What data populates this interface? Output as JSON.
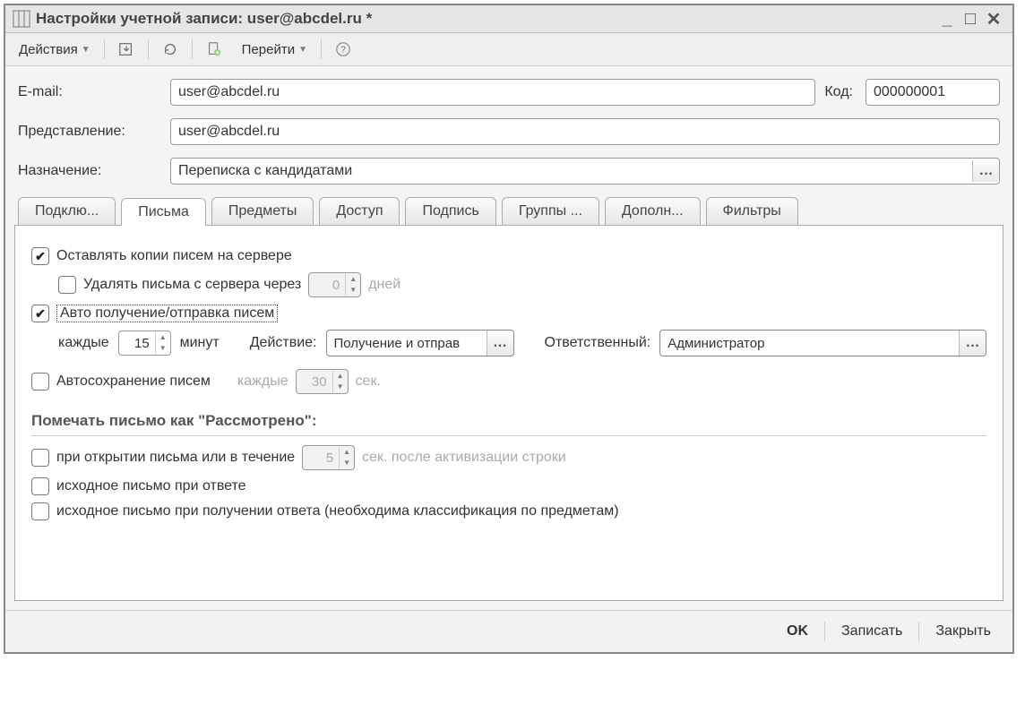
{
  "window": {
    "title": "Настройки учетной записи: user@abcdel.ru *"
  },
  "toolbar": {
    "actions_label": "Действия",
    "goto_label": "Перейти"
  },
  "form": {
    "email_label": "E-mail:",
    "email_value": "user@abcdel.ru",
    "code_label": "Код:",
    "code_value": "000000001",
    "repr_label": "Представление:",
    "repr_value": "user@abcdel.ru",
    "purpose_label": "Назначение:",
    "purpose_value": "Переписка с кандидатами"
  },
  "tabs": [
    "Подклю...",
    "Письма",
    "Предметы",
    "Доступ",
    "Подпись",
    "Группы ...",
    "Дополн...",
    "Фильтры"
  ],
  "letters": {
    "keep_copies": "Оставлять копии писем на сервере",
    "delete_after_label": "Удалять письма с сервера через",
    "delete_after_value": "0",
    "days_label": "дней",
    "auto_send_recv": "Авто получение/отправка писем",
    "every_label": "каждые",
    "every_value": "15",
    "minutes_label": "минут",
    "action_label": "Действие:",
    "action_value": "Получение и отправ",
    "responsible_label": "Ответственный:",
    "responsible_value": "Администратор",
    "autosave_label": "Автосохранение писем",
    "autosave_every_label": "каждые",
    "autosave_value": "30",
    "sec_label": "сек.",
    "section_title": "Помечать письмо как \"Рассмотрено\":",
    "on_open_label": "при открытии письма или в течение",
    "on_open_value": "5",
    "on_open_suffix": "сек. после активизации строки",
    "on_reply_label": "исходное письмо при ответе",
    "on_receive_reply_label": "исходное письмо при получении ответа (необходима классификация по предметам)"
  },
  "footer": {
    "ok": "OK",
    "save": "Записать",
    "close": "Закрыть"
  }
}
